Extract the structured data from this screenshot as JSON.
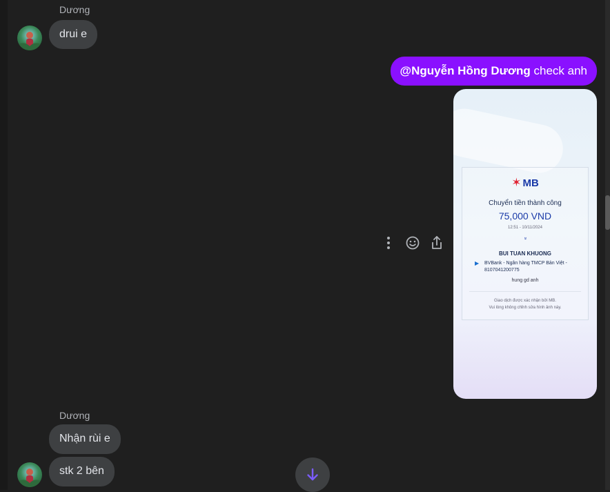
{
  "messages": {
    "first": {
      "sender": "Dương",
      "text": "drui e"
    },
    "outgoing": {
      "mention": "@Nguyễn Hồng Dương",
      "text": " check anh"
    },
    "receipt": {
      "bank": "MB",
      "title": "Chuyển tiền thành công",
      "amount": "75,000 VND",
      "time": "12:51 - 10/11/2024",
      "chevron": "»",
      "recipient": "BUI TUAN KHUONG",
      "bank_line": "BVBank - Ngân hàng TMCP Bản Việt - 8107041200775",
      "note": "hung gd anh",
      "footer_1": "Giao dịch được xác nhận bởi MB.",
      "footer_2": "Vui lòng không chỉnh sửa hình ảnh này."
    },
    "second": {
      "sender": "Dương",
      "text_1": "Nhận rùi e",
      "text_2": "stk 2 bên"
    }
  },
  "icons": {
    "more": "more-vertical-icon",
    "react": "smiley-icon",
    "share": "share-icon",
    "jump": "arrow-down-icon"
  },
  "colors": {
    "outgoing_bubble": "#8a10ff",
    "incoming_bubble": "#3e4042",
    "background": "#1f1f1f",
    "jump_arrow": "#7b5cff"
  }
}
